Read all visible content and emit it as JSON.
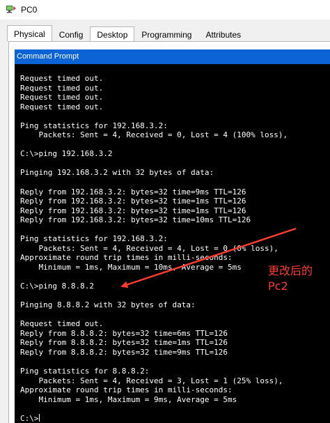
{
  "window": {
    "title": "PC0",
    "icon": "packet-tracer-pc-icon"
  },
  "tabs": [
    {
      "label": "Physical",
      "active": true
    },
    {
      "label": "Config",
      "active": false
    },
    {
      "label": "Desktop",
      "active": false
    },
    {
      "label": "Programming",
      "active": false
    },
    {
      "label": "Attributes",
      "active": false
    }
  ],
  "command_prompt": {
    "title": "Command Prompt",
    "lines": [
      "Request timed out.",
      "Request timed out.",
      "Request timed out.",
      "Request timed out.",
      "",
      "Ping statistics for 192.168.3.2:",
      "    Packets: Sent = 4, Received = 0, Lost = 4 (100% loss),",
      "",
      "C:\\>ping 192.168.3.2",
      "",
      "Pinging 192.168.3.2 with 32 bytes of data:",
      "",
      "Reply from 192.168.3.2: bytes=32 time=9ms TTL=126",
      "Reply from 192.168.3.2: bytes=32 time=1ms TTL=126",
      "Reply from 192.168.3.2: bytes=32 time=1ms TTL=126",
      "Reply from 192.168.3.2: bytes=32 time=10ms TTL=126",
      "",
      "Ping statistics for 192.168.3.2:",
      "    Packets: Sent = 4, Received = 4, Lost = 0 (0% loss),",
      "Approximate round trip times in milli-seconds:",
      "    Minimum = 1ms, Maximum = 10ms, Average = 5ms",
      "",
      "C:\\>ping 8.8.8.2",
      "",
      "Pinging 8.8.8.2 with 32 bytes of data:",
      "",
      "Request timed out.",
      "Reply from 8.8.8.2: bytes=32 time=6ms TTL=126",
      "Reply from 8.8.8.2: bytes=32 time=1ms TTL=126",
      "Reply from 8.8.8.2: bytes=32 time=9ms TTL=126",
      "",
      "Ping statistics for 8.8.8.2:",
      "    Packets: Sent = 4, Received = 3, Lost = 1 (25% loss),",
      "Approximate round trip times in milli-seconds:",
      "    Minimum = 1ms, Maximum = 9ms, Average = 5ms",
      "",
      "C:\\>"
    ]
  },
  "annotation": {
    "text": "更改后的\nPc2",
    "color": "#ff3b30"
  },
  "colors": {
    "header_blue": "#0c63d6",
    "terminal_bg": "#000000",
    "terminal_fg": "#ffffff"
  }
}
